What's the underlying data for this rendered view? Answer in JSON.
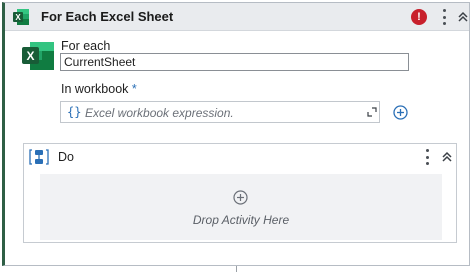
{
  "header": {
    "title": "For Each Excel Sheet",
    "error_badge": "!",
    "icons": [
      "excel-icon",
      "error-icon",
      "more-options-icon",
      "collapse-icon"
    ]
  },
  "for_each": {
    "label": "For each",
    "value": "CurrentSheet"
  },
  "workbook": {
    "label": "In workbook",
    "required_marker": "*",
    "braces": "{}",
    "placeholder": "Excel workbook expression."
  },
  "do_section": {
    "title": "Do",
    "drop_text": "Drop Activity Here"
  },
  "colors": {
    "accent_green": "#2e5f45",
    "excel_green": "#1e7b45",
    "error_red": "#c8202c",
    "link_blue": "#2a6fb6",
    "required_blue": "#2a6fb6",
    "header_bg": "#e9ebee"
  }
}
